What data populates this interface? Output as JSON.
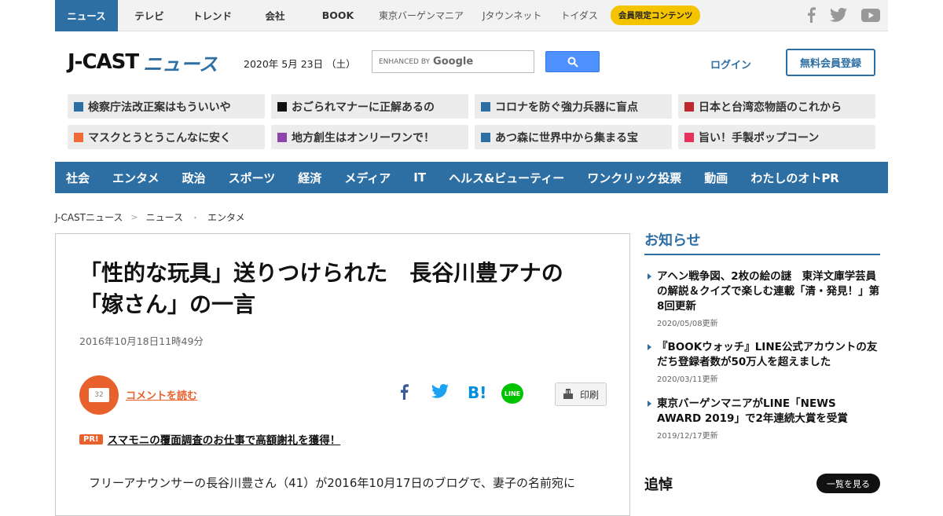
{
  "topbar": {
    "tabs": [
      "ニュース",
      "テレビ",
      "トレンド",
      "会社",
      "BOOK"
    ],
    "sites": [
      "東京バーゲンマニア",
      "Jタウンネット",
      "トイダス"
    ],
    "premium": "会員限定コンテンツ",
    "social_icons": [
      "facebook-icon",
      "twitter-icon",
      "youtube-icon"
    ]
  },
  "header": {
    "logo_main": "J-CAST",
    "logo_sub": "ニュース",
    "date": "2020年 5月 23日 （土）",
    "search_prefix": "ENHANCED BY",
    "search_brand": "Google",
    "login": "ログイン",
    "register": "無料会員登録"
  },
  "topics": [
    {
      "label": "検察庁法改正案はもういいや",
      "color": "#2d6ea3"
    },
    {
      "label": "おごられマナーに正解あるの",
      "color": "#111111"
    },
    {
      "label": "コロナを防ぐ強力兵器に盲点",
      "color": "#2d6ea3"
    },
    {
      "label": "日本と台湾恋物語のこれから",
      "color": "#c0282d"
    },
    {
      "label": "マスクとうとうこんなに安く",
      "color": "#f06a35"
    },
    {
      "label": "地方創生はオンリーワンで！",
      "color": "#8e44ad"
    },
    {
      "label": "あつ森に世界中から集まる宝",
      "color": "#2d6ea3"
    },
    {
      "label": "旨い！手製ポップコーン",
      "color": "#e8305a"
    }
  ],
  "categories": [
    "社会",
    "エンタメ",
    "政治",
    "スポーツ",
    "経済",
    "メディア",
    "IT",
    "ヘルス&ビューティー",
    "ワンクリック投票",
    "動画",
    "わたしのオトPR"
  ],
  "breadcrumb": [
    "J-CASTニュース",
    "ニュース",
    "エンタメ"
  ],
  "article": {
    "headline_1": "「性的な玩具」送りつけられた　長谷川豊アナの",
    "headline_2": "「嫁さん」の一言",
    "date": "2016年10月18日11時49分",
    "comment_count": "32",
    "comment_link": "コメントを読む",
    "print": "印刷",
    "pr_badge": "PR!",
    "pr_text": "スマモニの覆面調査のお仕事で高額謝礼を獲得！",
    "lead": "フリーアナウンサーの長谷川豊さん（41）が2016年10月17日のブログで、妻子の名前宛に"
  },
  "sidebar": {
    "title": "お知らせ",
    "notices": [
      {
        "title": "アヘン戦争図、2枚の絵の謎　東洋文庫学芸員の解説＆クイズで楽しむ連載「清・発見！」第8回更新",
        "date": "2020/05/08更新"
      },
      {
        "title": "『BOOKウォッチ』LINE公式アカウントの友だち登録者数が50万人を超えました",
        "date": "2020/03/11更新"
      },
      {
        "title": "東京バーゲンマニアがLINE「NEWS AWARD 2019」で2年連続大賞を受賞",
        "date": "2019/12/17更新"
      }
    ],
    "section2_title": "追悼",
    "see_all": "一覧を見る"
  }
}
